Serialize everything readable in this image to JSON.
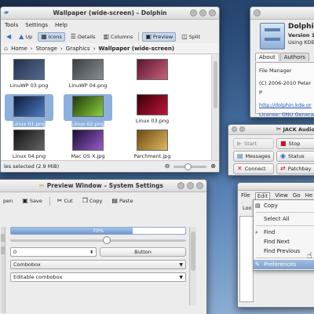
{
  "dolphin": {
    "title": "Wallpaper (wide-screen) – Dolphin",
    "menu": [
      "Tools",
      "Settings",
      "Help"
    ],
    "toolbar": {
      "up": "Up",
      "icons": "Icons",
      "details": "Details",
      "columns": "Columns",
      "preview": "Preview",
      "split": "Split"
    },
    "breadcrumb": {
      "home": "Home",
      "storage": "Storage",
      "graphics": "Graphics",
      "current": "Wallpaper (wide-screen)"
    },
    "files": [
      {
        "name": "LinuWP 03.png",
        "selected": false,
        "colors": [
          "#24314d",
          "#566b8f"
        ]
      },
      {
        "name": "LinuWP 04.png",
        "selected": false,
        "colors": [
          "#3a3f44",
          "#8a8f94"
        ]
      },
      {
        "name": "",
        "selected": false,
        "colors": [
          "#5a1630",
          "#c96078"
        ]
      },
      {
        "name": "Linux 01.png",
        "selected": true,
        "colors": [
          "#0d1c3a",
          "#4e7ac0"
        ]
      },
      {
        "name": "Linux 02.png",
        "selected": true,
        "colors": [
          "#1c3a0c",
          "#8fcf3c"
        ]
      },
      {
        "name": "Linux 03.png",
        "selected": false,
        "colors": [
          "#3a0008",
          "#c0143a"
        ]
      },
      {
        "name": "Linux 04.png",
        "selected": false,
        "colors": [
          "#111111",
          "#666666"
        ]
      },
      {
        "name": "Mac OS X.jpg",
        "selected": false,
        "colors": [
          "#1a0d3a",
          "#9a5cc8"
        ]
      },
      {
        "name": "Parchment.jpg",
        "selected": false,
        "colors": [
          "#6b4a12",
          "#e0b860"
        ]
      }
    ],
    "status": "les selected (2.9 MiB)"
  },
  "about": {
    "app_name": "Dolphi",
    "version": "Version 1",
    "using": "Using KDE",
    "tabs": [
      "About",
      "Authors"
    ],
    "description": "File Manager",
    "copyright": "(C) 2006-2010 Peter P",
    "url": "http://dolphin.kde.or",
    "license": "License: GNU General"
  },
  "jack": {
    "title": "JACK Audio",
    "buttons": [
      "Start",
      "Stop",
      "Messages",
      "Status",
      "Connect",
      "Patchbay"
    ]
  },
  "settings": {
    "title": "Preview Window – System Settings",
    "toolbar": [
      "pen",
      "Save",
      "Cut",
      "Copy",
      "Paste"
    ],
    "progress_text": "70%",
    "progress_value": 0.7,
    "slider_value": 0.55,
    "spin_value": "0",
    "button_label": "Button",
    "combo1": "Combobox",
    "combo2": "Editable combobox"
  },
  "editor": {
    "menu": [
      "File",
      "Edit",
      "View",
      "Go",
      "He"
    ],
    "side_label": "Loo",
    "edit_menu": [
      {
        "label": "Copy",
        "icon": "copy-icon",
        "glyph": "▤"
      },
      {
        "label": "Select All",
        "icon": "",
        "glyph": ""
      },
      {
        "label": "Find",
        "icon": "binoculars-icon",
        "glyph": "⌕"
      },
      {
        "label": "Find Next",
        "icon": "",
        "glyph": ""
      },
      {
        "label": "Find Previous",
        "icon": "",
        "glyph": ""
      },
      {
        "label": "Preferences",
        "icon": "wrench-icon",
        "glyph": "✎"
      }
    ]
  }
}
